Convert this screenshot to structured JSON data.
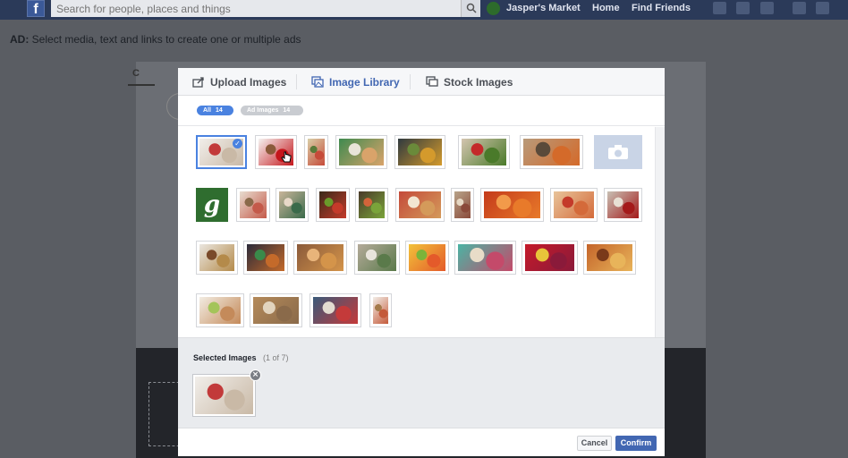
{
  "topbar": {
    "logo": "f",
    "search_placeholder": "Search for people, places and things",
    "page_name": "Jasper's Market",
    "home": "Home",
    "find_friends": "Find Friends"
  },
  "adbar": {
    "prefix": "AD:",
    "text": "Select media, text and links to create one or multiple ads"
  },
  "modal": {
    "tabs": [
      {
        "label": "Upload Images",
        "icon": "upload-icon"
      },
      {
        "label": "Image Library",
        "icon": "image-library-icon",
        "active": true
      },
      {
        "label": "Stock Images",
        "icon": "stock-images-icon"
      }
    ],
    "filters": [
      {
        "label": "All",
        "count": "14",
        "active": true
      },
      {
        "label": "Ad Images",
        "count": "14",
        "active": false
      }
    ],
    "library": [
      {
        "subject": "yogurt bowl with strawberries",
        "selected": true,
        "c1": "#f1eeea",
        "c2": "#c9b9a6",
        "c3": "#c23a3a"
      },
      {
        "subject": "red apple",
        "selected": false,
        "c1": "#f5f3f1",
        "c2": "#c4161c",
        "c3": "#8a5a3a"
      },
      {
        "subject": "produce stand",
        "selected": false,
        "c1": "#d9cfa8",
        "c2": "#c64b3a",
        "c3": "#5a7a3a"
      },
      {
        "subject": "burger on plate",
        "selected": false,
        "c1": "#3f8a4f",
        "c2": "#d9a36a",
        "c3": "#e8e4d8"
      },
      {
        "subject": "salad plate",
        "selected": false,
        "c1": "#2f3a3f",
        "c2": "#d49a2c",
        "c3": "#6a8a3a"
      },
      {
        "subject": "vegetables",
        "selected": false,
        "c1": "#d4c5b0",
        "c2": "#4a7a2a",
        "c3": "#c42a2a"
      },
      {
        "subject": "market stall",
        "selected": false,
        "c1": "#b89a7a",
        "c2": "#d46a2a",
        "c3": "#5a4a3a"
      },
      {
        "subject": "photo placeholder",
        "selected": false,
        "placeholder": true
      },
      {
        "subject": "Jasper's Market logo",
        "selected": false,
        "logo": true
      },
      {
        "subject": "sliced meats",
        "selected": false,
        "c1": "#e8ddd0",
        "c2": "#c45a4a",
        "c3": "#8a6a4a"
      },
      {
        "subject": "shopkeeper",
        "selected": false,
        "c1": "#c9b59a",
        "c2": "#3a6a4a",
        "c3": "#e8d8c8"
      },
      {
        "subject": "produce crates",
        "selected": false,
        "c1": "#3a2a1a",
        "c2": "#c43a2a",
        "c3": "#6a9a2a"
      },
      {
        "subject": "vegetable market",
        "selected": false,
        "c1": "#4a3a2a",
        "c2": "#7aa43a",
        "c3": "#d4643a"
      },
      {
        "subject": "lattice pie",
        "selected": false,
        "c1": "#c44a3a",
        "c2": "#d49a5a",
        "c3": "#f2e6d2"
      },
      {
        "subject": "cutting board",
        "selected": false,
        "c1": "#b8a48a",
        "c2": "#8a4a3a",
        "c3": "#e6d8c4"
      },
      {
        "subject": "pumpkin tart",
        "selected": false,
        "c1": "#c43a1a",
        "c2": "#e87a2a",
        "c3": "#f29a4a"
      },
      {
        "subject": "peaches",
        "selected": false,
        "c1": "#e8c49a",
        "c2": "#d46a3a",
        "c3": "#c43a2a"
      },
      {
        "subject": "jam jar",
        "selected": false,
        "c1": "#c8c0b4",
        "c2": "#a41a1a",
        "c3": "#e8e0d4"
      },
      {
        "subject": "granola bowl",
        "selected": false,
        "c1": "#eae6e0",
        "c2": "#b48a4a",
        "c3": "#7a4a2a"
      },
      {
        "subject": "spice market",
        "selected": false,
        "c1": "#2a2a3a",
        "c2": "#c46a2a",
        "c3": "#3a8a4a"
      },
      {
        "subject": "pears",
        "selected": false,
        "c1": "#8a5a3a",
        "c2": "#d4944a",
        "c3": "#e8b47a"
      },
      {
        "subject": "herb plate",
        "selected": false,
        "c1": "#b4aa9a",
        "c2": "#5a7a4a",
        "c3": "#e8e4dc"
      },
      {
        "subject": "citrus slices",
        "selected": false,
        "c1": "#f2c23a",
        "c2": "#e45a2a",
        "c3": "#7ab43a"
      },
      {
        "subject": "farmers market",
        "selected": false,
        "c1": "#4ab4a4",
        "c2": "#c44a6a",
        "c3": "#e8dcc8"
      },
      {
        "subject": "strawberries",
        "selected": false,
        "c1": "#c41a2a",
        "c2": "#8a1a3a",
        "c3": "#e8c43a"
      },
      {
        "subject": "pizza",
        "selected": false,
        "c1": "#c4642a",
        "c2": "#e8b45a",
        "c3": "#7a3a1a"
      },
      {
        "subject": "ice cream cones",
        "selected": false,
        "c1": "#f2ece2",
        "c2": "#c48a5a",
        "c3": "#a4c45a"
      },
      {
        "subject": "cookie board",
        "selected": false,
        "c1": "#b48a5a",
        "c2": "#8a6a4a",
        "c3": "#e2d4be"
      },
      {
        "subject": "picnic basket",
        "selected": false,
        "c1": "#3a5a7a",
        "c2": "#c43a3a",
        "c3": "#e2dcd0"
      },
      {
        "subject": "small tart",
        "selected": false,
        "c1": "#f2eee8",
        "c2": "#c45a3a",
        "c3": "#a47a4a"
      }
    ],
    "selected_title": "Selected Images",
    "selected_count": "(1 of 7)",
    "selected_images": [
      {
        "subject": "yogurt bowl with strawberries",
        "c1": "#f1eeea",
        "c2": "#c9b9a6",
        "c3": "#c23a3a"
      }
    ],
    "cancel": "Cancel",
    "confirm": "Confirm"
  }
}
